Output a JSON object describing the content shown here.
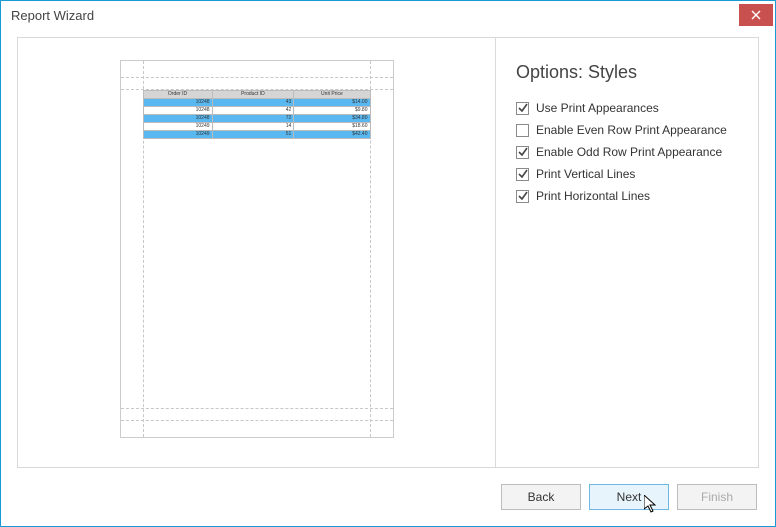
{
  "window": {
    "title": "Report Wizard"
  },
  "options": {
    "heading": "Options: Styles",
    "items": [
      {
        "key": "use_print_appearances",
        "label": "Use Print Appearances",
        "checked": true
      },
      {
        "key": "enable_even_row",
        "label": "Enable Even Row Print Appearance",
        "checked": false
      },
      {
        "key": "enable_odd_row",
        "label": "Enable Odd Row Print Appearance",
        "checked": true
      },
      {
        "key": "print_vertical_lines",
        "label": "Print Vertical Lines",
        "checked": true
      },
      {
        "key": "print_horizontal_lines",
        "label": "Print Horizontal Lines",
        "checked": true
      }
    ]
  },
  "buttons": {
    "back": "Back",
    "next": "Next",
    "finish": "Finish"
  },
  "preview": {
    "columns": [
      "Order ID",
      "Product ID",
      "Unit Price"
    ],
    "rows": [
      {
        "order_id": "10248",
        "product_id": "43",
        "unit_price": "$14.00"
      },
      {
        "order_id": "10248",
        "product_id": "42",
        "unit_price": "$9.80"
      },
      {
        "order_id": "10248",
        "product_id": "72",
        "unit_price": "$34.80"
      },
      {
        "order_id": "10249",
        "product_id": "14",
        "unit_price": "$18.60"
      },
      {
        "order_id": "10249",
        "product_id": "51",
        "unit_price": "$42.40"
      }
    ]
  }
}
